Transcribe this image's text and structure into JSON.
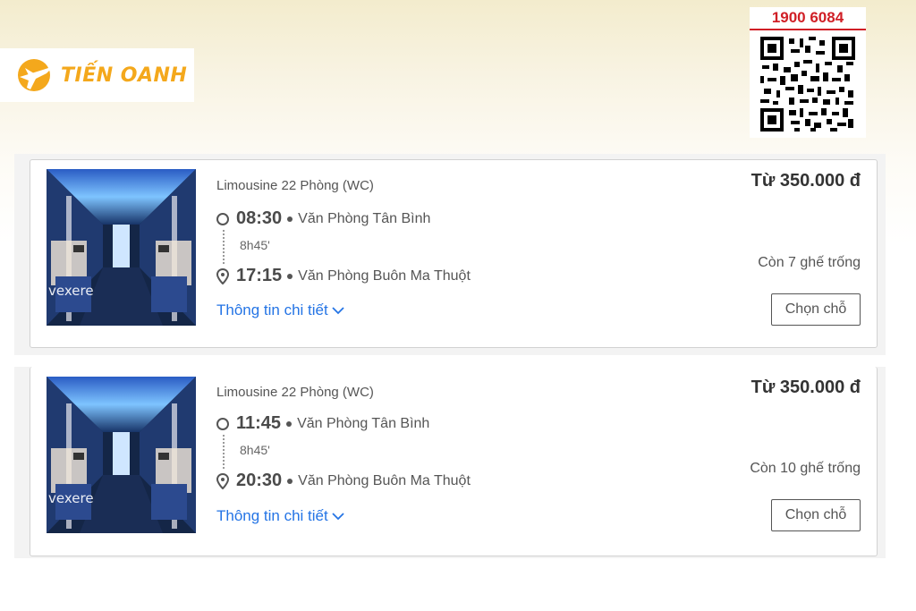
{
  "brand": {
    "name": "TIẾN OANH",
    "accent": "#f4a81c"
  },
  "hotline": {
    "number": "1900 6084",
    "color": "#d01f26"
  },
  "qr": {
    "icon": "qr-code-icon"
  },
  "trips": [
    {
      "bus_type": "Limousine 22 Phòng (WC)",
      "depart_time": "08:30",
      "depart_place": "Văn Phòng Tân Bình",
      "duration": "8h45'",
      "arrive_time": "17:15",
      "arrive_place": "Văn Phòng Buôn Ma Thuột",
      "detail_link": "Thông tin chi tiết",
      "price": "Từ 350.000 đ",
      "seats_left": "Còn 7 ghế trống",
      "choose_label": "Chọn chỗ",
      "image_watermark": "vexere"
    },
    {
      "bus_type": "Limousine 22 Phòng (WC)",
      "depart_time": "11:45",
      "depart_place": "Văn Phòng Tân Bình",
      "duration": "8h45'",
      "arrive_time": "20:30",
      "arrive_place": "Văn Phòng Buôn Ma Thuột",
      "detail_link": "Thông tin chi tiết",
      "price": "Từ 350.000 đ",
      "seats_left": "Còn 10 ghế trống",
      "choose_label": "Chọn chỗ",
      "image_watermark": "vexere"
    }
  ],
  "colors": {
    "link": "#2474e5",
    "text": "#555555",
    "border": "#d2d2d2"
  }
}
